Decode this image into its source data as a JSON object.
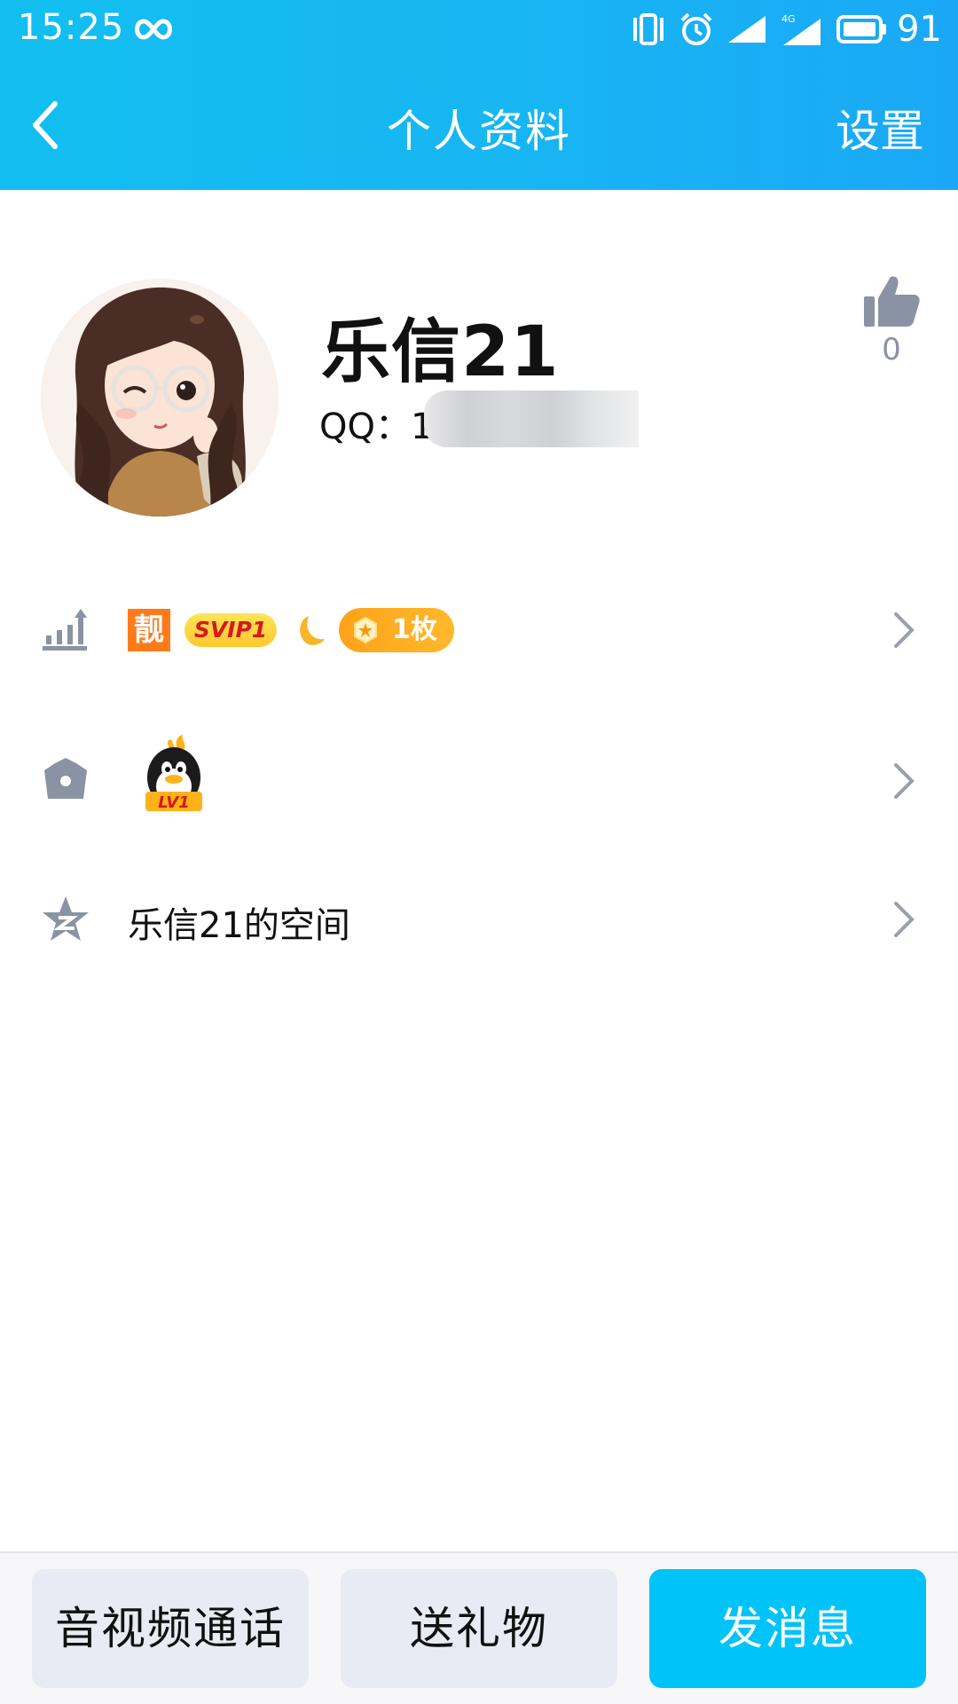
{
  "status_bar": {
    "time": "15:25",
    "battery": "91",
    "network": "4G"
  },
  "nav": {
    "title": "个人资料",
    "settings_label": "设置"
  },
  "profile": {
    "name": "乐信21",
    "qq_prefix": "QQ：1",
    "like_count": "0"
  },
  "badges": {
    "jing": "靓",
    "svip": "SVIP1",
    "coin": "1枚"
  },
  "level": {
    "badge_text": "LV1"
  },
  "space": {
    "label": "乐信21的空间"
  },
  "bottom_bar": {
    "call_label": "音视频通话",
    "gift_label": "送礼物",
    "message_label": "发消息"
  },
  "colors": {
    "header_gradient_start": "#12bff0",
    "header_gradient_end": "#1aa8f6",
    "primary_button": "#00c3f9",
    "secondary_button": "#e8ebf4",
    "icon_gray": "#8a93a3",
    "badge_orange": "#ff7b1a"
  },
  "icons": {
    "back": "chevron-left-icon",
    "like": "thumbs-up-icon",
    "level": "bar-chart-up-icon",
    "vip": "crown-icon",
    "space": "qzone-star-icon",
    "row_arrow": "chevron-right-icon"
  }
}
